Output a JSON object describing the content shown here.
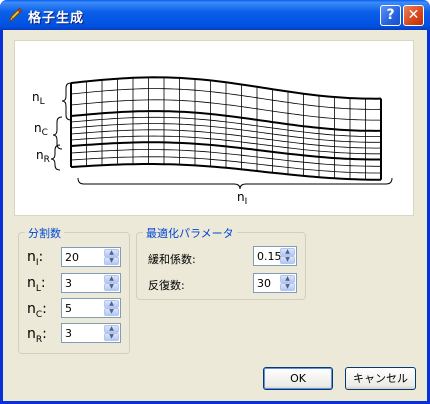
{
  "window": {
    "title": "格子生成",
    "help_label": "?",
    "close_label": "✕",
    "icon": "pencil-icon"
  },
  "preview": {
    "labels": {
      "nL": {
        "base": "n",
        "sub": "L"
      },
      "nC": {
        "base": "n",
        "sub": "C"
      },
      "nR": {
        "base": "n",
        "sub": "R"
      },
      "nI": {
        "base": "n",
        "sub": "I"
      }
    }
  },
  "divisions": {
    "title": "分割数",
    "fields": [
      {
        "base": "n",
        "sub": "I",
        "suffix": ":",
        "value": "20"
      },
      {
        "base": "n",
        "sub": "L",
        "suffix": ":",
        "value": "3"
      },
      {
        "base": "n",
        "sub": "C",
        "suffix": ":",
        "value": "5"
      },
      {
        "base": "n",
        "sub": "R",
        "suffix": ":",
        "value": "3"
      }
    ]
  },
  "optimization": {
    "title": "最適化パラメータ",
    "relaxation_label": "緩和係数:",
    "relaxation_value": "0.15",
    "iterations_label": "反復数:",
    "iterations_value": "30"
  },
  "buttons": {
    "ok": "OK",
    "cancel": "キャンセル"
  }
}
